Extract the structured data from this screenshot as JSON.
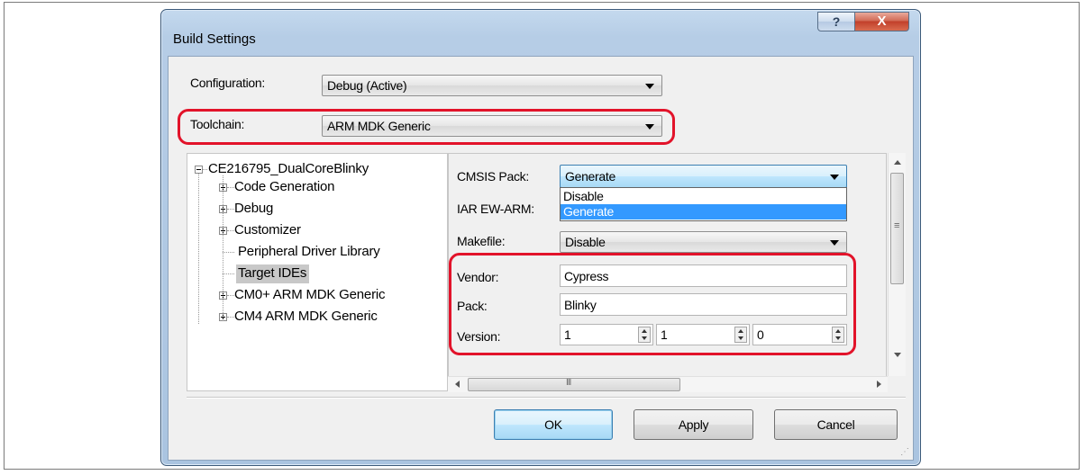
{
  "window": {
    "title": "Build Settings",
    "help_glyph": "?",
    "close_glyph": "X"
  },
  "configuration": {
    "label": "Configuration:",
    "value": "Debug (Active)"
  },
  "toolchain": {
    "label": "Toolchain:",
    "value": "ARM MDK Generic"
  },
  "tree": {
    "root": "CE216795_DualCoreBlinky",
    "items": [
      {
        "label": "Code Generation"
      },
      {
        "label": "Debug"
      },
      {
        "label": "Customizer"
      },
      {
        "label": "Peripheral Driver Library"
      },
      {
        "label": "Target IDEs"
      },
      {
        "label": "CM0+ ARM MDK Generic"
      },
      {
        "label": "CM4 ARM MDK Generic"
      }
    ],
    "selected": "Target IDEs"
  },
  "props": {
    "cmsis_pack": {
      "label": "CMSIS Pack:",
      "value": "Generate"
    },
    "cmsis_options": [
      "Disable",
      "Generate"
    ],
    "iar": {
      "label": "IAR EW-ARM:"
    },
    "makefile": {
      "label": "Makefile:",
      "value": "Disable"
    },
    "vendor": {
      "label": "Vendor:",
      "value": "Cypress"
    },
    "pack": {
      "label": "Pack:",
      "value": "Blinky"
    },
    "version": {
      "label": "Version:",
      "major": "1",
      "minor": "1",
      "patch": "0"
    }
  },
  "hscroll_glyph": "III",
  "vscroll_glyph": "≡",
  "buttons": {
    "ok": "OK",
    "apply": "Apply",
    "cancel": "Cancel"
  },
  "colors": {
    "highlight": "#e2132a",
    "selection": "#3399ff",
    "close": "#c2402a"
  }
}
